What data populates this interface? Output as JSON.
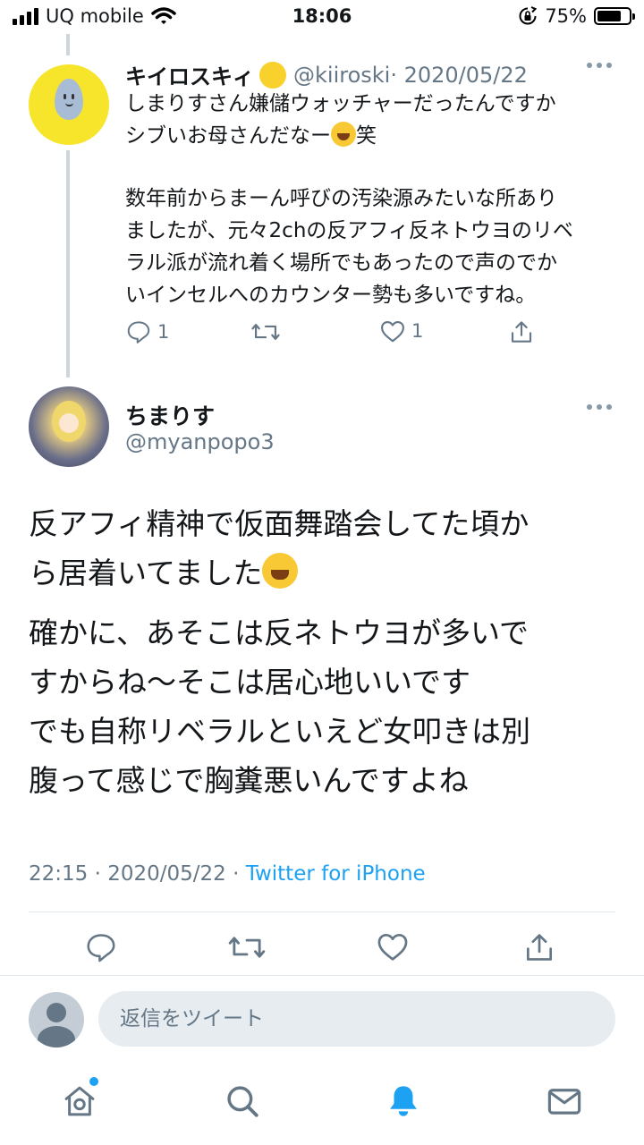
{
  "status_bar": {
    "carrier": "UQ mobile",
    "time": "18:06",
    "battery_percent": "75%",
    "battery_level": 0.75
  },
  "parent_tweet": {
    "display_name": "キイロスキィ",
    "handle": "@kiiroski",
    "date": "· 2020/05/22",
    "lines": {
      "l1": "しまりすさん嫌儲ウォッチャーだったんですか",
      "l2a": "シブいお母さんだなー",
      "l2b": "笑",
      "l3": "数年前からまーん呼びの汚染源みたいな所あり",
      "l4": "ましたが、元々2chの反アフィ反ネトウヨのリベ",
      "l5": "ラル派が流れ着く場所でもあったので声のでか",
      "l6": "いインセルへのカウンター勢も多いですね。"
    },
    "reply_count": "1",
    "like_count": "1"
  },
  "main_tweet": {
    "display_name": "ちまりす",
    "handle": "@myanpopo3",
    "lines": {
      "l1": "反アフィ精神で仮面舞踏会してた頃か",
      "l2": "ら居着いてました",
      "l3": "確かに、あそこは反ネトウヨが多いで",
      "l4": "すからね～そこは居心地いいです",
      "l5": "でも自称リベラルといえど女叩きは別",
      "l6": "腹って感じで胸糞悪いんですよね"
    },
    "timestamp": "22:15 · 2020/05/22 · ",
    "source": "Twitter for iPhone"
  },
  "reply_bar": {
    "placeholder": "返信をツイート"
  },
  "colors": {
    "accent": "#1da1f2",
    "secondary_text": "#657786",
    "divider": "#e1e8ed"
  },
  "icons": [
    "signal-icon",
    "wifi-icon",
    "rotation-lock-icon",
    "battery-icon",
    "more-icon",
    "reply-icon",
    "retweet-icon",
    "like-icon",
    "share-icon",
    "home-icon",
    "search-icon",
    "notifications-icon",
    "messages-icon"
  ]
}
